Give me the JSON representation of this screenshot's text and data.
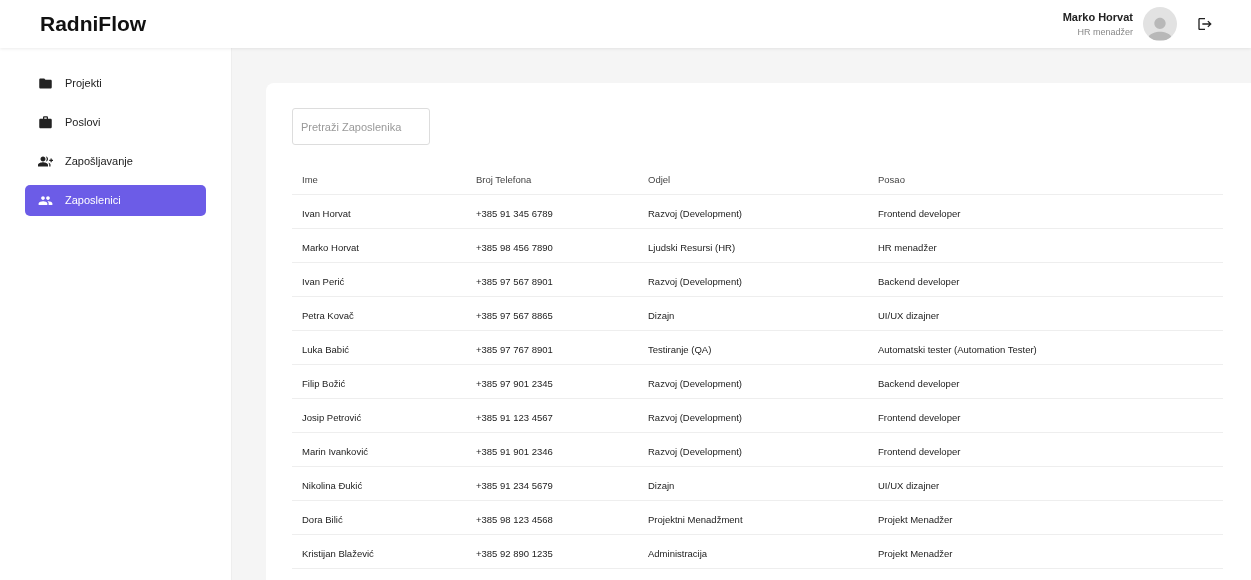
{
  "app": {
    "logo": "RadniFlow"
  },
  "user": {
    "name": "Marko Horvat",
    "role": "HR menadžer"
  },
  "sidebar": {
    "items": [
      {
        "label": "Projekti",
        "selected": false
      },
      {
        "label": "Poslovi",
        "selected": false
      },
      {
        "label": "Zapošljavanje",
        "selected": false
      },
      {
        "label": "Zaposlenici",
        "selected": true
      }
    ]
  },
  "search": {
    "placeholder": "Pretraži Zaposlenika"
  },
  "table": {
    "columns": [
      "Ime",
      "Broj Telefona",
      "Odjel",
      "Posao"
    ],
    "rows": [
      [
        "Ivan Horvat",
        "+385 91 345 6789",
        "Razvoj (Development)",
        "Frontend developer"
      ],
      [
        "Marko Horvat",
        "+385 98 456 7890",
        "Ljudski Resursi (HR)",
        "HR menadžer"
      ],
      [
        "Ivan Perić",
        "+385 97 567 8901",
        "Razvoj (Development)",
        "Backend developer"
      ],
      [
        "Petra Kovač",
        "+385 97 567 8865",
        "Dizajn",
        "UI/UX dizajner"
      ],
      [
        "Luka Babić",
        "+385 97 767 8901",
        "Testiranje (QA)",
        "Automatski tester (Automation Tester)"
      ],
      [
        "Filip Božić",
        "+385 97 901 2345",
        "Razvoj (Development)",
        "Backend developer"
      ],
      [
        "Josip Petrović",
        "+385 91 123 4567",
        "Razvoj (Development)",
        "Frontend developer"
      ],
      [
        "Marin Ivanković",
        "+385 91 901 2346",
        "Razvoj (Development)",
        "Frontend developer"
      ],
      [
        "Nikolina Đukić",
        "+385 91 234 5679",
        "Dizajn",
        "UI/UX dizajner"
      ],
      [
        "Dora Bilić",
        "+385 98 123 4568",
        "Projektni Menadžment",
        "Projekt Menadžer"
      ],
      [
        "Kristijan Blažević",
        "+385 92 890 1235",
        "Administracija",
        "Projekt Menadžer"
      ]
    ]
  }
}
